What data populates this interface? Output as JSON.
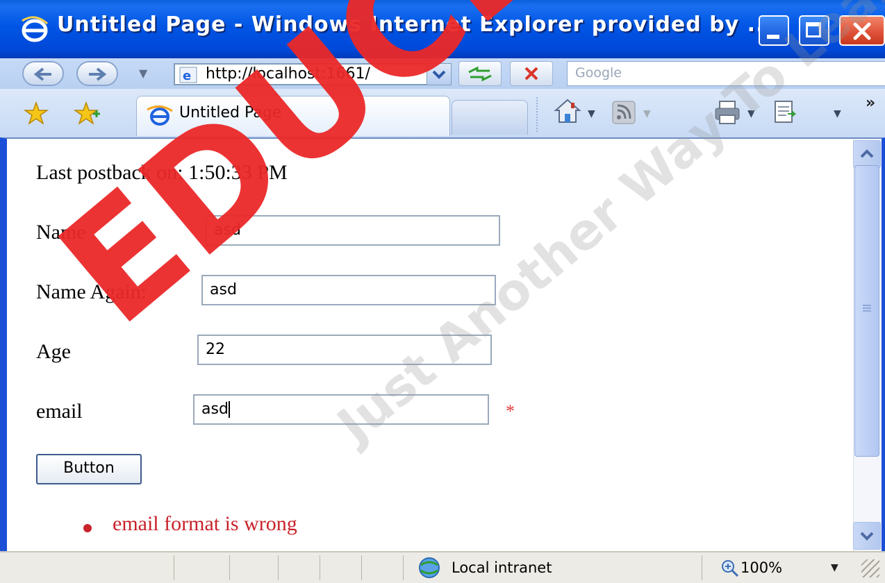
{
  "window": {
    "title": "Untitled Page - Windows Internet Explorer provided by ..."
  },
  "address_bar": {
    "url": "http://localhost:1661/",
    "search_placeholder": "Google"
  },
  "tab": {
    "label": "Untitled Page"
  },
  "toolbar": {
    "overflow_label": "»"
  },
  "page": {
    "last_postback": "Last postback on: 1:50:33 PM",
    "name_label": "Name",
    "name_value": "asd",
    "name_again_label": "Name Again:",
    "name_again_value": "asd",
    "age_label": "Age",
    "age_value": "22",
    "email_label": "email",
    "email_value": "asd",
    "email_required_marker": "*",
    "button_label": "Button",
    "validation_error": "email format is wrong"
  },
  "status_bar": {
    "zone": "Local intranet",
    "zoom": "100%"
  },
  "watermark": {
    "main": "EDUCLA",
    "tagline": "Just Another Way To Learn"
  },
  "colors": {
    "titlebar": "#0055e5",
    "error": "#c8222a",
    "watermark": "#eb2828"
  }
}
